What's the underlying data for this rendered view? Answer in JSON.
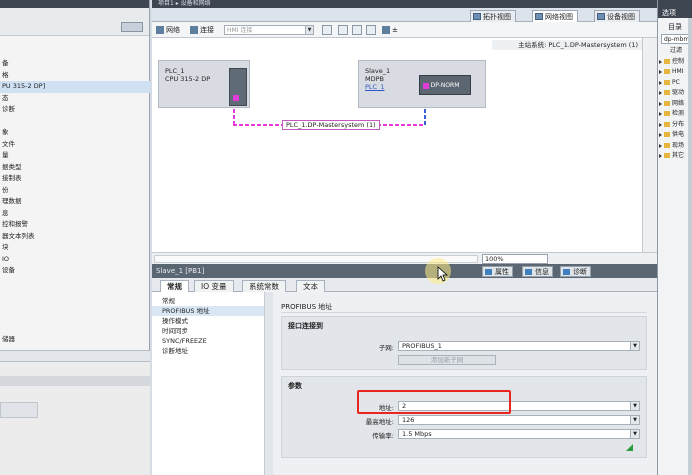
{
  "left_tree": {
    "rows": [
      "备",
      "格",
      "PU 315-2 DP]",
      "态",
      "诊断",
      "",
      "象",
      "文件",
      "量",
      "据类型",
      "接制表",
      "份",
      "理数据",
      "息",
      "控和报警",
      "器文本列表",
      "块",
      "IO",
      "设备",
      "",
      "",
      "",
      "",
      "",
      "储器"
    ],
    "selected_index": 2
  },
  "center": {
    "window_title": "项目1 ▸ 设备和网络",
    "view_tabs": [
      "拓扑视图",
      "网络视图",
      "设备视图"
    ],
    "active_view_tab": 1,
    "toolbar": {
      "network_label": "网络",
      "connection_label": "连接",
      "connection_select": "HMI 连接",
      "zoom_hint": "±"
    },
    "master_system": "主站系统: PLC_1.DP-Mastersystem (1)",
    "devices": {
      "plc_name": "PLC_1",
      "plc_type": "CPU 315-2 DP",
      "slave_name": "Slave_1",
      "slave_type": "MDPB",
      "slave_link": "PLC_1",
      "slave_module": "DP-NORM"
    },
    "bus_label": "PLC_1.DP-Mastersystem (1)",
    "zoom_value": "100%"
  },
  "inspector": {
    "header": "Slave_1 [PB1]",
    "right_tabs": [
      "属性",
      "信息",
      "诊断"
    ],
    "subtabs": [
      "常规",
      "IO 变量",
      "系统常数",
      "文本"
    ],
    "active_subtab": 0,
    "nav_items": [
      "常规",
      "PROFIBUS 地址",
      "操作模式",
      "时间同步",
      "SYNC/FREEZE",
      "诊断地址"
    ],
    "selected_nav": 1,
    "section_title": "PROFIBUS 地址",
    "interface_group": {
      "title": "接口连接到",
      "subnet_label": "子网:",
      "subnet_value": "PROFIBUS_1",
      "add_button": "添加新子网"
    },
    "params_group": {
      "title": "参数",
      "address_label": "地址:",
      "address_value": "2",
      "highest_label": "最高地址:",
      "highest_value": "126",
      "rate_label": "传输率:",
      "rate_value": "1.5 Mbps"
    }
  },
  "right_panel": {
    "title": "选项",
    "catalog_label": "目录",
    "search_value": "dp-mbm...",
    "filter_label": "过滤",
    "items": [
      "控制",
      "HMI",
      "PC",
      "驱动",
      "网络",
      "检测",
      "分布",
      "供电",
      "现场",
      "其它"
    ]
  },
  "colors": {
    "bus_magenta": "#e33bd9",
    "highlight_red": "#e8261f",
    "accent_green": "#2e9b3b"
  }
}
